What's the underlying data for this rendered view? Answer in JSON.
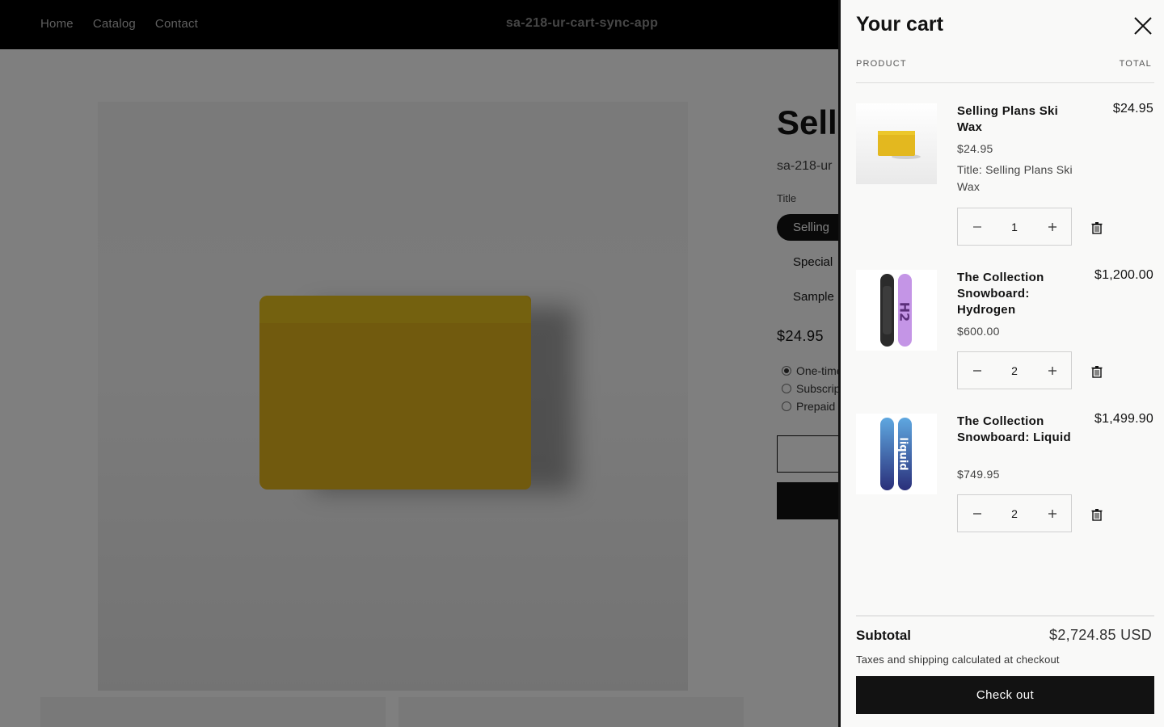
{
  "header": {
    "nav": [
      "Home",
      "Catalog",
      "Contact"
    ],
    "store_name": "sa-218-ur-cart-sync-app"
  },
  "product": {
    "title_visible": "Sell",
    "vendor_visible": "sa-218-ur",
    "option_label": "Title",
    "options_visible": [
      "Selling",
      "Special",
      "Sample"
    ],
    "price": "$24.95",
    "purchase_options_visible": [
      "One-time",
      "Subscrip",
      "Prepaid"
    ]
  },
  "cart": {
    "title": "Your cart",
    "col_product": "PRODUCT",
    "col_total": "TOTAL",
    "items": [
      {
        "name": "Selling Plans Ski Wax",
        "unit_price": "$24.95",
        "variant": "Title: Selling Plans Ski Wax",
        "quantity": "1",
        "line_total": "$24.95",
        "thumb_icon": "ski-wax-image"
      },
      {
        "name": "The Collection Snowboard: Hydrogen",
        "unit_price": "$600.00",
        "quantity": "2",
        "line_total": "$1,200.00",
        "thumb_icon": "snowboard-hydrogen-image"
      },
      {
        "name": "The Collection Snowboard: Liquid",
        "unit_price": "$749.95",
        "quantity": "2",
        "line_total": "$1,499.90",
        "thumb_icon": "snowboard-liquid-image"
      }
    ],
    "subtotal_label": "Subtotal",
    "subtotal_value": "$2,724.85 USD",
    "tax_note": "Taxes and shipping calculated at checkout",
    "checkout_label": "Check out"
  },
  "icons": {
    "close": "close-icon",
    "minus": "minus-icon",
    "plus": "plus-icon",
    "delete": "trash-icon"
  }
}
